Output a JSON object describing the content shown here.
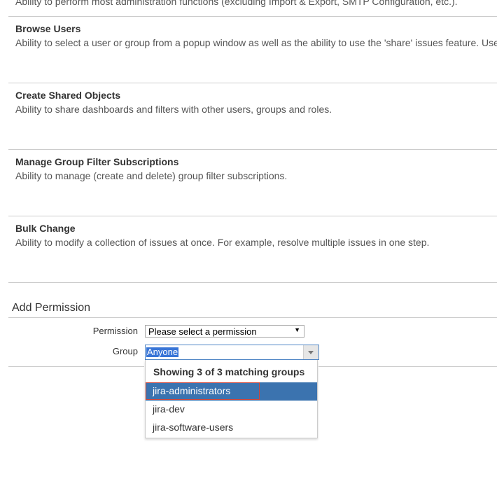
{
  "top_description": "Ability to perform most administration functions (excluding Import & Export, SMTP Configuration, etc.).",
  "permissions": [
    {
      "title": "Browse Users",
      "description": "Ability to select a user or group from a popup window as well as the ability to use the 'share' issues feature. Use"
    },
    {
      "title": "Create Shared Objects",
      "description": "Ability to share dashboards and filters with other users, groups and roles."
    },
    {
      "title": "Manage Group Filter Subscriptions",
      "description": "Ability to manage (create and delete) group filter subscriptions."
    },
    {
      "title": "Bulk Change",
      "description": "Ability to modify a collection of issues at once. For example, resolve multiple issues in one step."
    }
  ],
  "add_permission": {
    "title": "Add Permission",
    "permission_label": "Permission",
    "permission_value": "Please select a permission",
    "group_label": "Group",
    "group_value": "Anyone"
  },
  "dropdown": {
    "header": "Showing 3 of 3 matching groups",
    "items": [
      "jira-administrators",
      "jira-dev",
      "jira-software-users"
    ],
    "active_index": 0
  }
}
